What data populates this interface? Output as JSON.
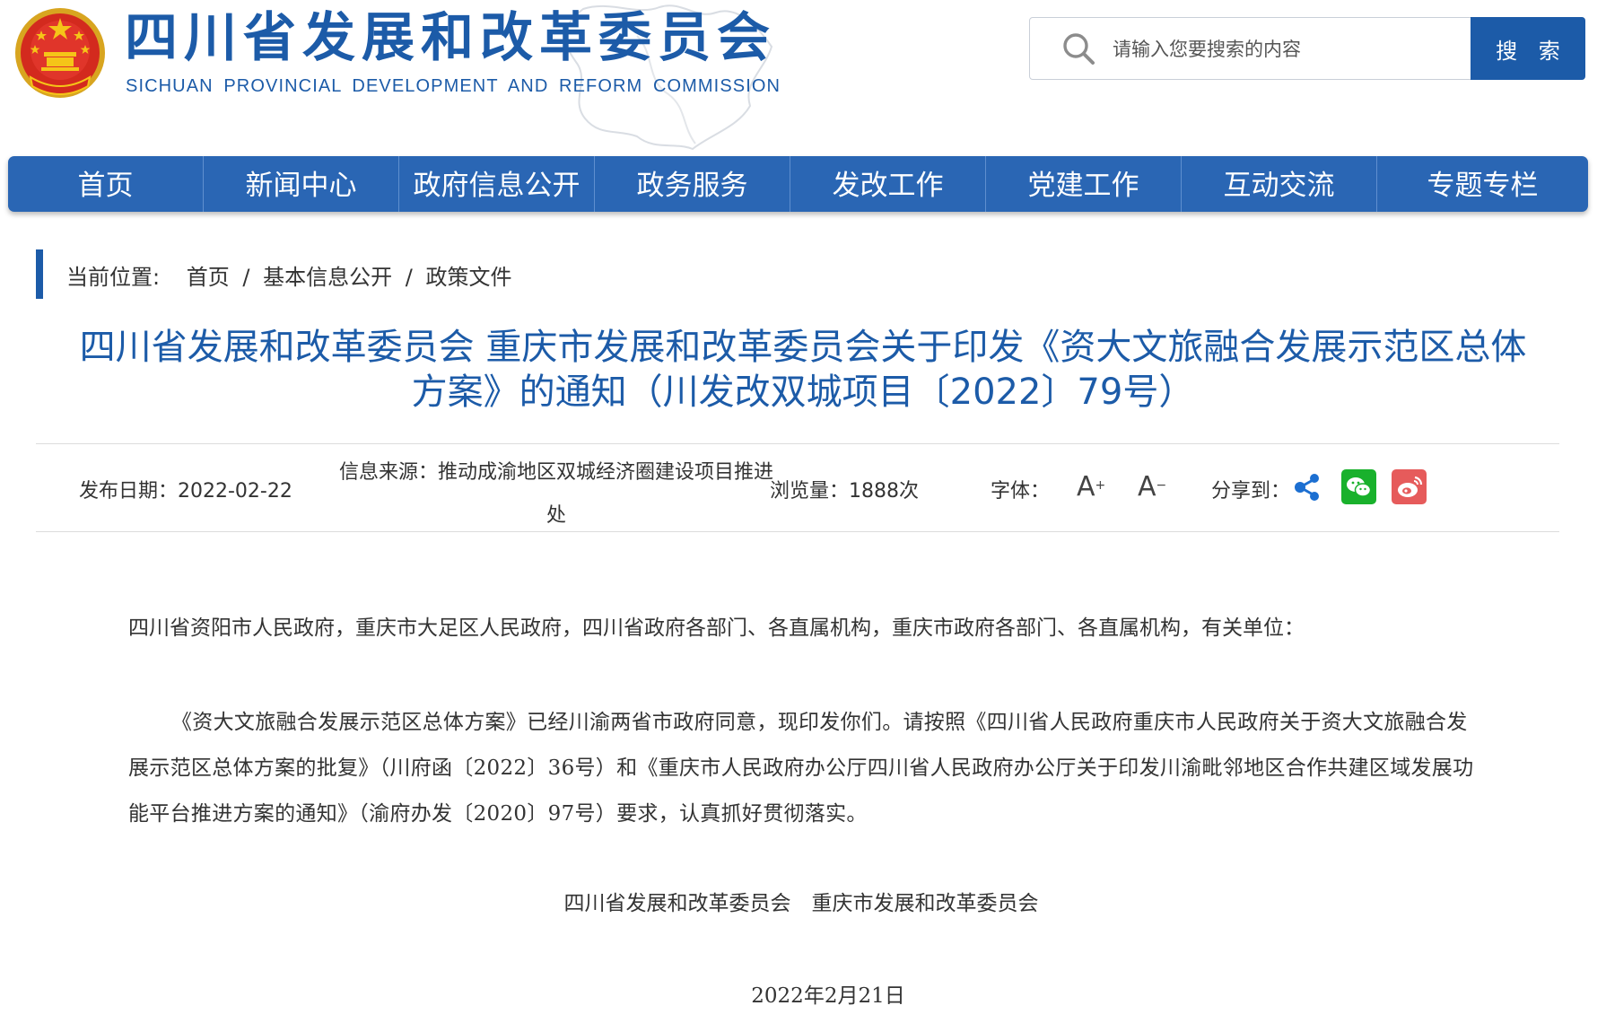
{
  "header": {
    "site_title": "四川省发展和改革委员会",
    "site_subtitle": "SICHUAN PROVINCIAL DEVELOPMENT AND REFORM COMMISSION",
    "search": {
      "placeholder": "请输入您要搜索的内容",
      "button_label": "搜 索"
    }
  },
  "nav": {
    "items": [
      {
        "label": "首页"
      },
      {
        "label": "新闻中心"
      },
      {
        "label": "政府信息公开"
      },
      {
        "label": "政务服务"
      },
      {
        "label": "发改工作"
      },
      {
        "label": "党建工作"
      },
      {
        "label": "互动交流"
      },
      {
        "label": "专题专栏"
      }
    ]
  },
  "breadcrumb": {
    "label": "当前位置:",
    "items": [
      "首页",
      "基本信息公开",
      "政策文件"
    ],
    "separator": "/"
  },
  "article": {
    "title": "四川省发展和改革委员会 重庆市发展和改革委员会关于印发《资大文旅融合发展示范区总体方案》的通知（川发改双城项目〔2022〕79号）",
    "meta": {
      "date_label": "发布日期：2022-02-22",
      "source_label": "信息来源：推动成渝地区双城经济圈建设项目推进处",
      "views_label": "浏览量：1888次",
      "font_label": "字体：",
      "font_increase": "A",
      "font_decrease": "A",
      "share_label": "分享到："
    },
    "salutation": "四川省资阳市人民政府，重庆市大足区人民政府，四川省政府各部门、各直属机构，重庆市政府各部门、各直属机构，有关单位：",
    "body": "《资大文旅融合发展示范区总体方案》已经川渝两省市政府同意，现印发你们。请按照《四川省人民政府重庆市人民政府关于资大文旅融合发展示范区总体方案的批复》（川府函〔2022〕36号）和《重庆市人民政府办公厅四川省人民政府办公厅关于印发川渝毗邻地区合作共建区域发展功能平台推进方案的通知》（渝府办发〔2020〕97号）要求，认真抓好贯彻落实。",
    "signature": "四川省发展和改革委员会　重庆市发展和改革委员会",
    "sign_date": "2022年2月21日"
  },
  "colors": {
    "brand_blue": "#1c5ba8",
    "nav_blue": "#2a66b4",
    "wechat_green": "#19b12c",
    "weibo_red": "#e65b5b"
  },
  "icons": {
    "emblem": "national-emblem-icon",
    "search": "search-icon",
    "share": "share-icon",
    "wechat": "wechat-icon",
    "weibo": "weibo-icon"
  }
}
